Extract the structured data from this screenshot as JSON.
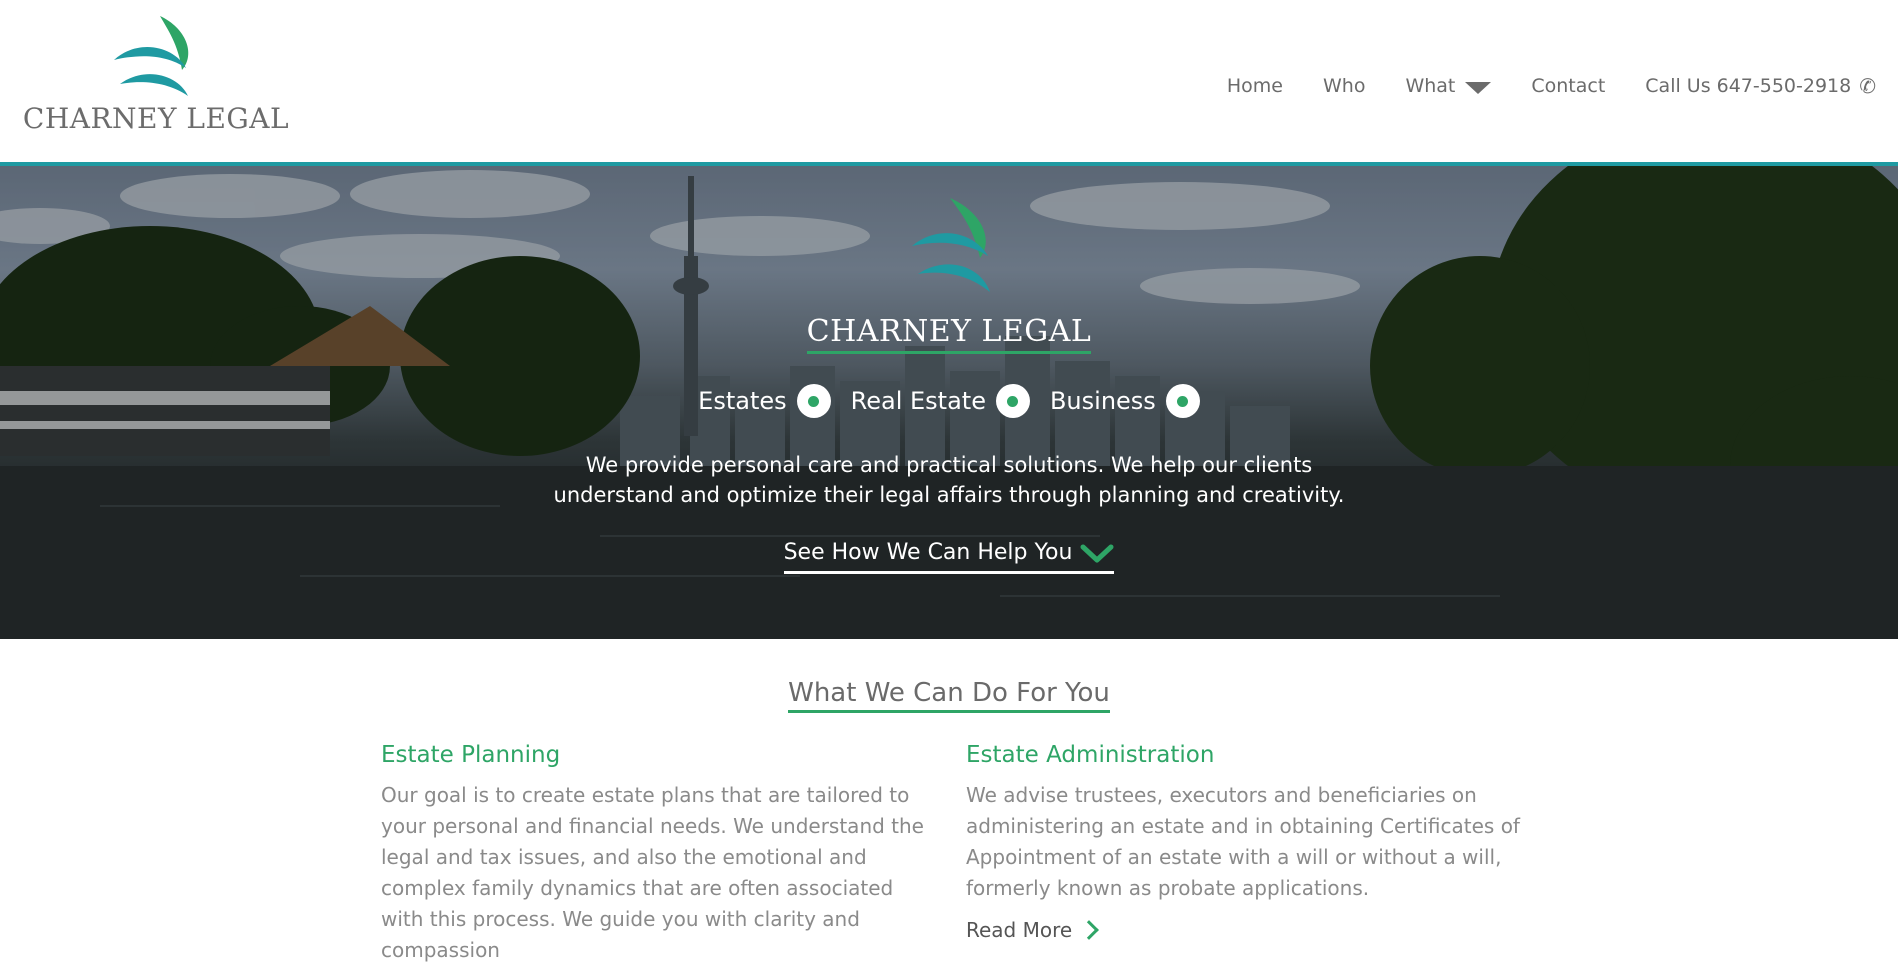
{
  "brand": {
    "name": "CHARNEY LEGAL"
  },
  "nav": {
    "items": [
      "Home",
      "Who",
      "What",
      "Contact"
    ],
    "call_label": "Call Us 647-550-2918",
    "phone_icon": "phone-icon",
    "dropdown_icon": "caret-down-icon"
  },
  "hero": {
    "title": "CHARNEY LEGAL",
    "pillars": [
      "Estates",
      "Real Estate",
      "Business"
    ],
    "description_line1": "We provide personal care and practical solutions. We help our clients",
    "description_line2": "understand and optimize their legal affairs through planning and creativity.",
    "cta_label": "See How We Can Help You"
  },
  "services": {
    "title": "What We Can Do For You",
    "items": [
      {
        "title": "Estate Planning",
        "body": "Our goal is to create estate plans that are tailored to your personal and financial needs. We understand the legal and tax issues, and also the emotional and complex family dynamics that are often associated with this process. We guide you with clarity and compassion"
      },
      {
        "title": "Estate Administration",
        "body": "We advise trustees, executors and beneficiaries on administering an estate and in obtaining Certificates of Appointment of an estate with a will or without a will, formerly known as probate applications.",
        "read_more": "Read More"
      }
    ]
  },
  "colors": {
    "accent_green": "#2ea566",
    "accent_teal": "#1f9aa2",
    "text_gray": "#6b6b6b"
  }
}
